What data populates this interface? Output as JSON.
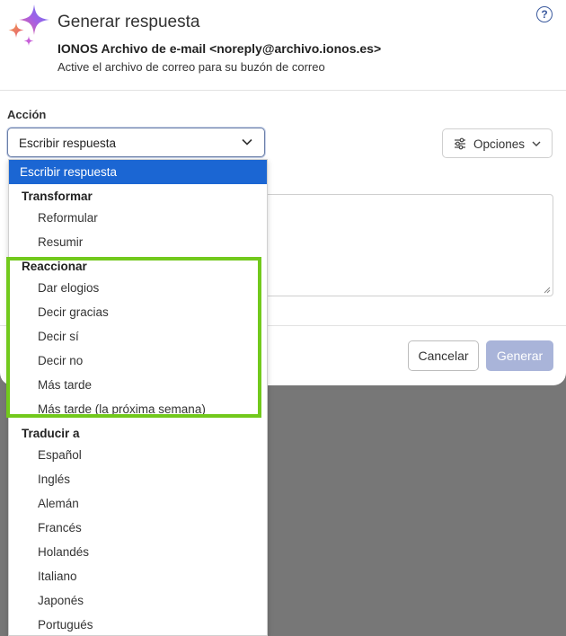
{
  "header": {
    "title": "Generar respuesta",
    "sender": "IONOS Archivo de e-mail <noreply@archivo.ionos.es>",
    "subtitle": "Active el archivo de correo para su buzón de correo",
    "help_label": "?"
  },
  "form": {
    "action_label": "Acción",
    "selected_action": "Escribir respuesta",
    "options_label": "Opciones"
  },
  "footer": {
    "cancel_label": "Cancelar",
    "generate_label": "Generar"
  },
  "dropdown": {
    "selected": "Escribir respuesta",
    "groups": [
      {
        "label": "Transformar",
        "items": [
          "Reformular",
          "Resumir"
        ]
      },
      {
        "label": "Reaccionar",
        "items": [
          "Dar elogios",
          "Decir gracias",
          "Decir sí",
          "Decir no",
          "Más tarde",
          "Más tarde (la próxima semana)"
        ]
      },
      {
        "label": "Traducir a",
        "items": [
          "Español",
          "Inglés",
          "Alemán",
          "Francés",
          "Holandés",
          "Italiano",
          "Japonés",
          "Portugués"
        ]
      }
    ]
  },
  "colors": {
    "selected_bg": "#1b66d3",
    "highlight_border": "#72c91c",
    "primary_disabled": "#a9b4d9"
  },
  "icons": {
    "logo": "sparkles-icon",
    "help": "help-circle-icon",
    "options": "sliders-icon",
    "chevron": "chevron-down-icon"
  }
}
